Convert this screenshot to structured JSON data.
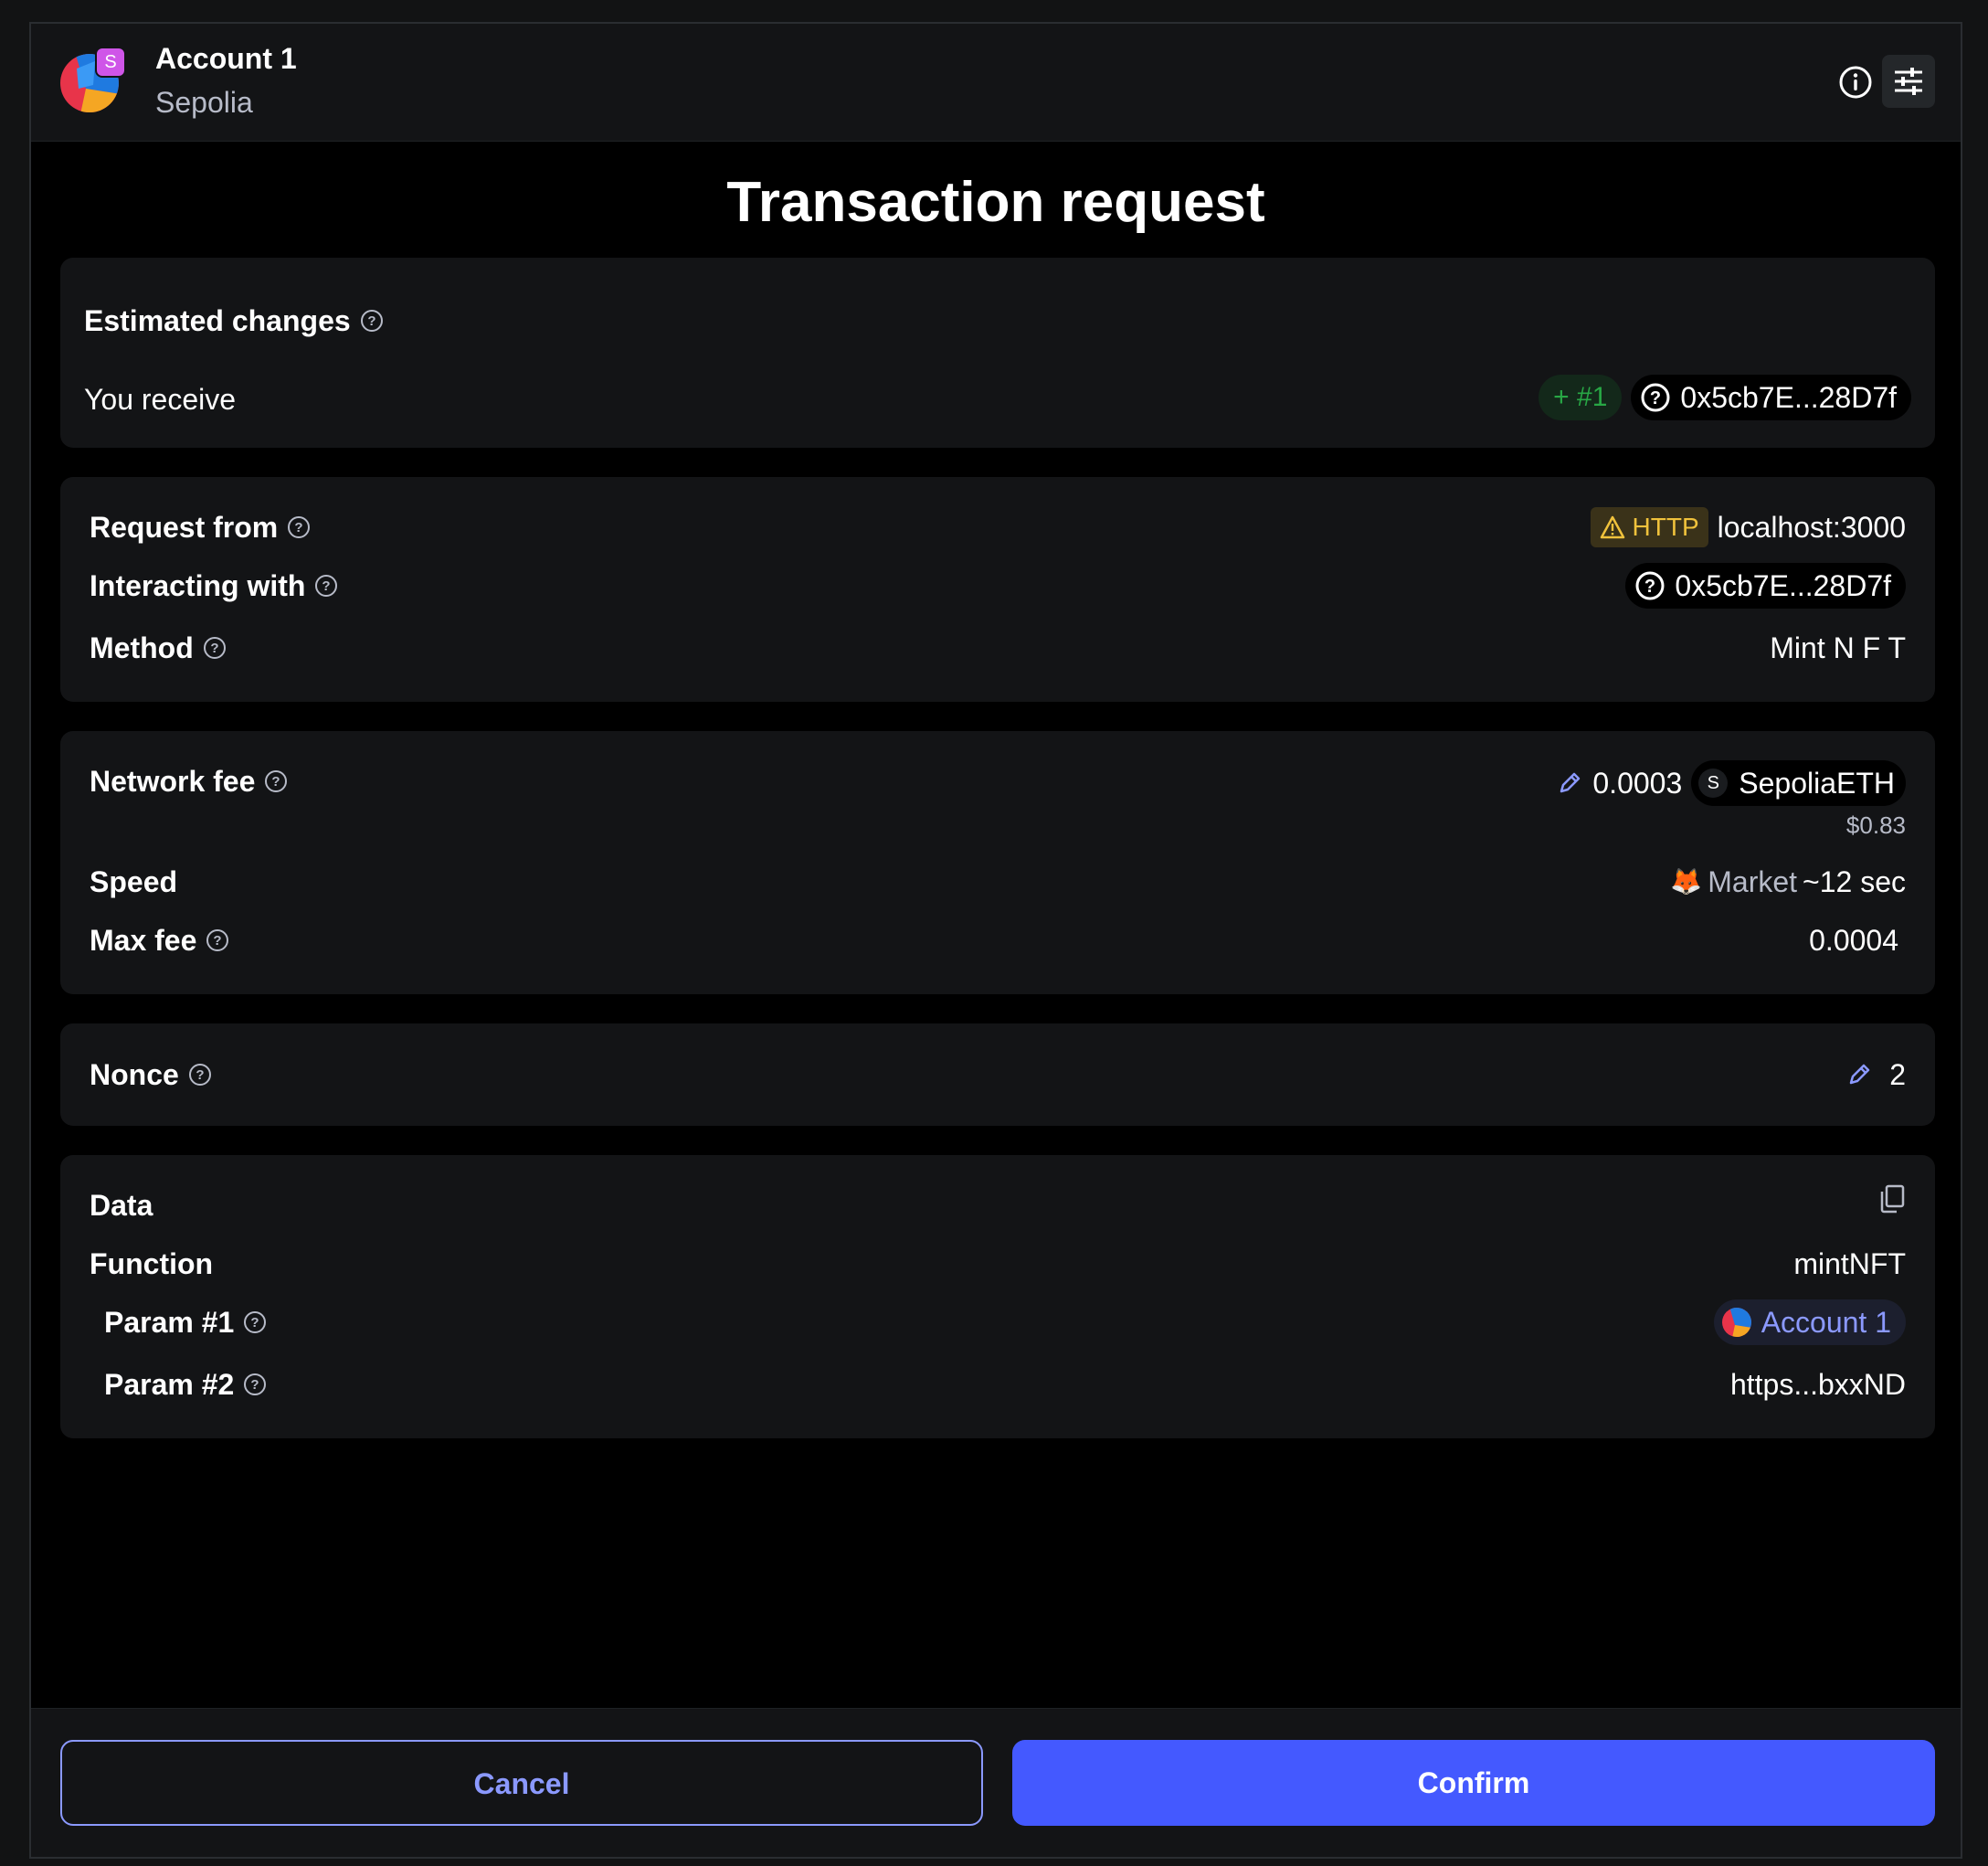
{
  "header": {
    "account_name": "Account 1",
    "network_name": "Sepolia",
    "network_badge": "S"
  },
  "title": "Transaction request",
  "estimated_changes": {
    "label": "Estimated changes",
    "row_label": "You receive",
    "amount": "+ #1",
    "address": "0x5cb7E...28D7f"
  },
  "request": {
    "from_label": "Request from",
    "http_badge": "HTTP",
    "origin": "localhost:3000",
    "interacting_label": "Interacting with",
    "interacting_address": "0x5cb7E...28D7f",
    "method_label": "Method",
    "method_value": "Mint N F T"
  },
  "fees": {
    "network_fee_label": "Network fee",
    "network_fee_value": "0.0003",
    "token_badge": "S",
    "token_name": "SepoliaETH",
    "fiat_value": "$0.83",
    "speed_label": "Speed",
    "speed_emoji": "🦊",
    "speed_value": "Market",
    "speed_time": "~12 sec",
    "max_fee_label": "Max fee",
    "max_fee_value": "0.0004"
  },
  "nonce": {
    "label": "Nonce",
    "value": "2"
  },
  "data": {
    "label": "Data",
    "function_label": "Function",
    "function_value": "mintNFT",
    "param1_label": "Param #1",
    "param1_value": "Account 1",
    "param2_label": "Param #2",
    "param2_value": "https...bxxND"
  },
  "footer": {
    "cancel_label": "Cancel",
    "confirm_label": "Confirm"
  },
  "colors": {
    "accent": "#4459ff",
    "accent_text": "#8b99ff",
    "success": "#28a745",
    "warning": "#f0c23c",
    "card": "#131416",
    "background": "#000000"
  }
}
